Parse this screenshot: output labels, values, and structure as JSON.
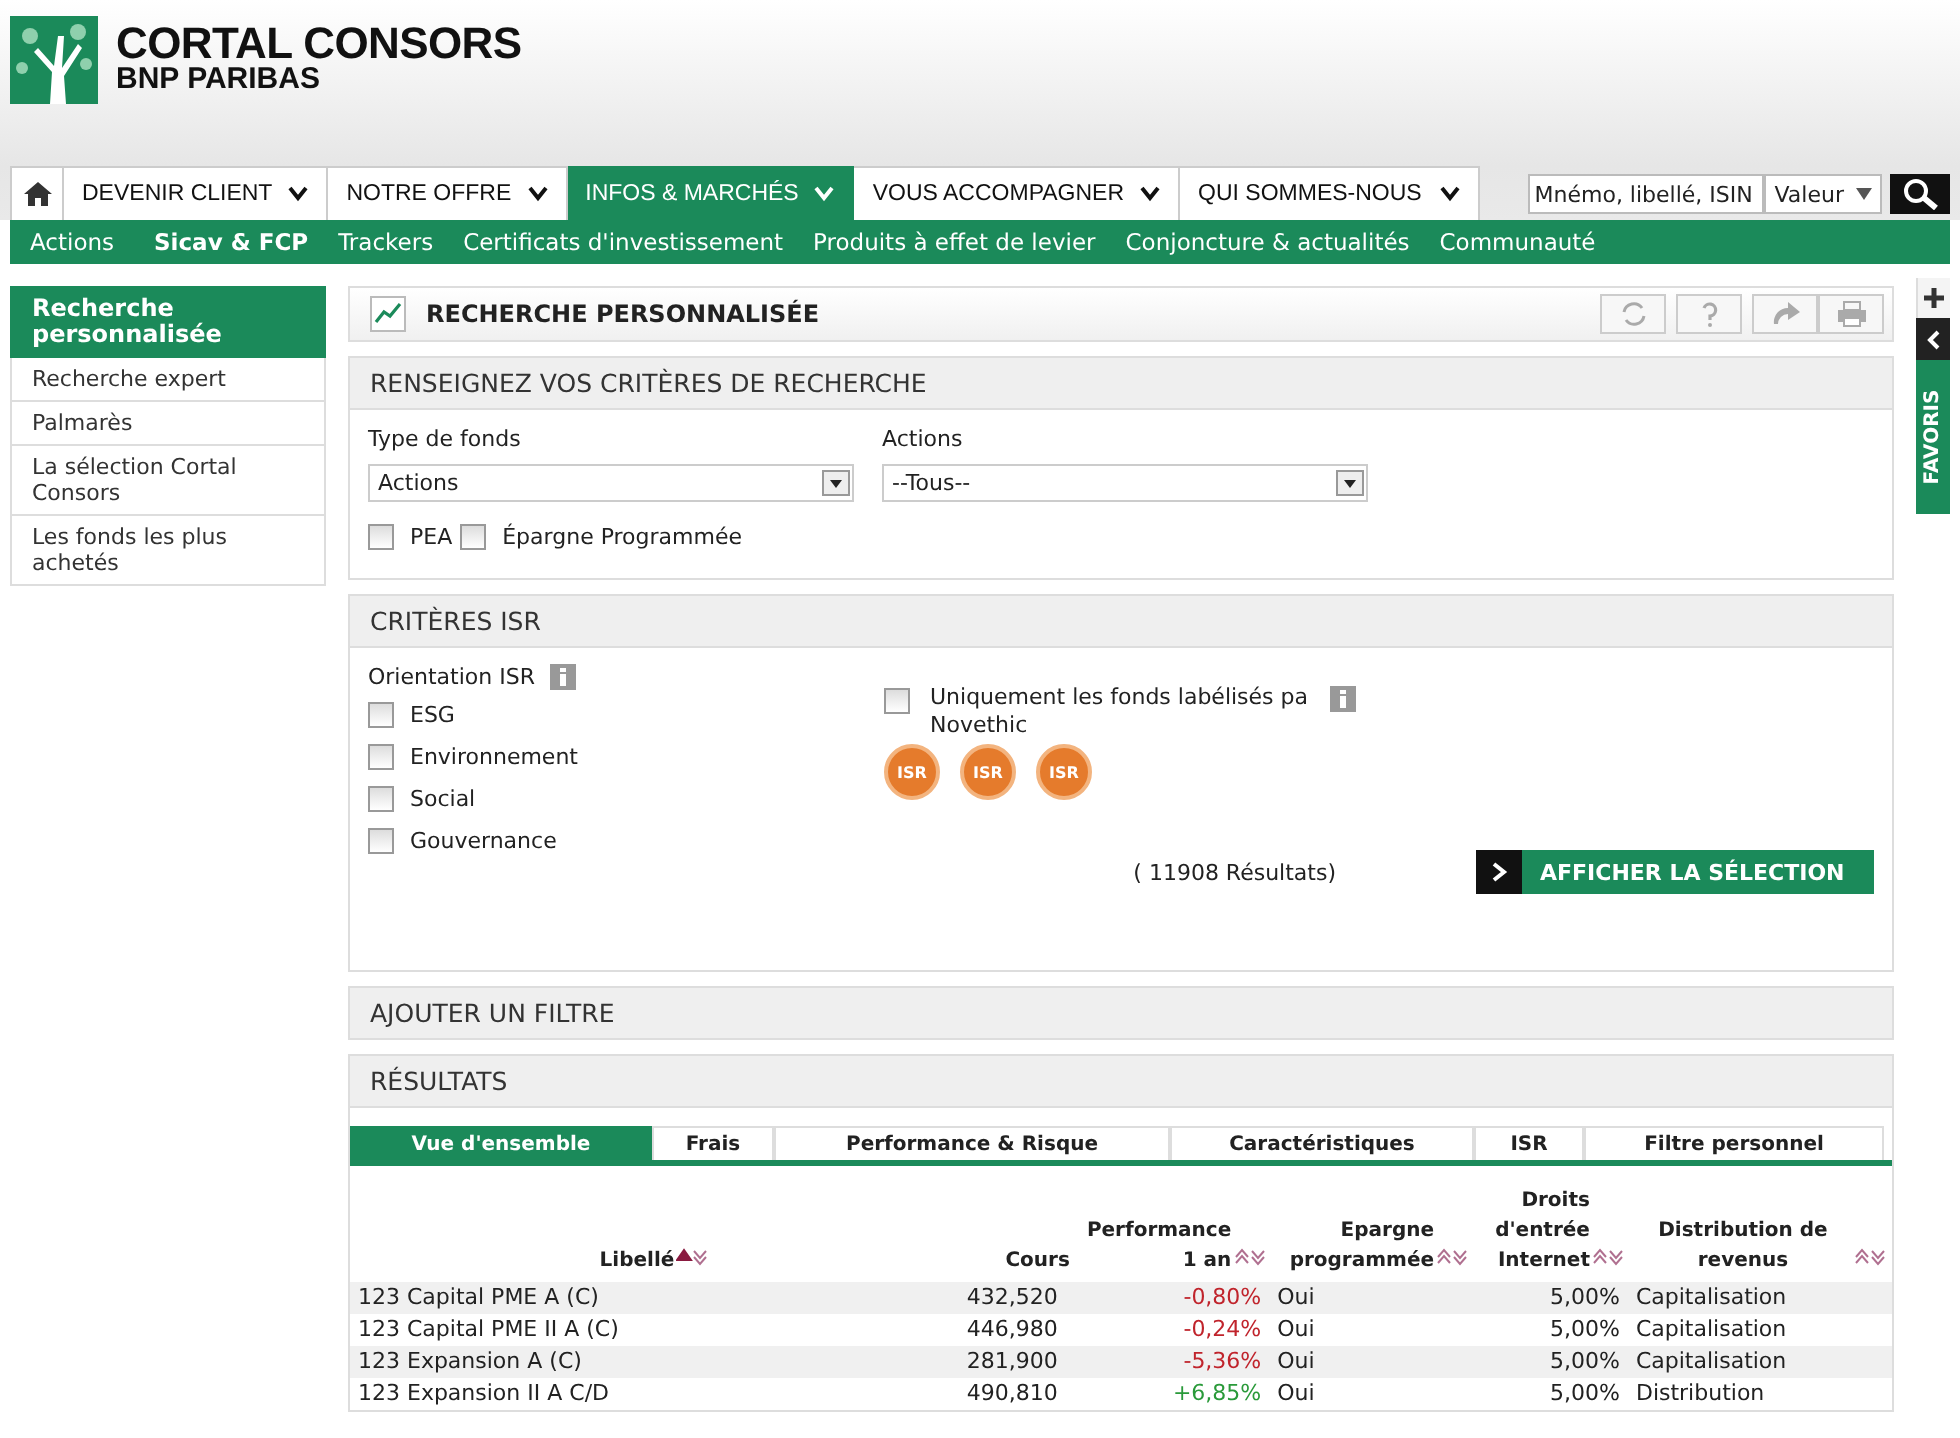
{
  "logo": {
    "name": "CORTAL CONSORS",
    "subname": "BNP PARIBAS"
  },
  "nav": {
    "items": [
      {
        "label": "DEVENIR CLIENT",
        "selected": false
      },
      {
        "label": "NOTRE OFFRE",
        "selected": false
      },
      {
        "label": "INFOS & MARCHÉS",
        "selected": true
      },
      {
        "label": "VOUS ACCOMPAGNER",
        "selected": false
      },
      {
        "label": "QUI SOMMES-NOUS",
        "selected": false
      }
    ],
    "search": {
      "value": "Mnémo, libellé, ISIN",
      "type": "Valeur"
    }
  },
  "subnav": [
    {
      "label": "Actions",
      "selected": false
    },
    {
      "label": "Sicav & FCP",
      "selected": true
    },
    {
      "label": "Trackers",
      "selected": false
    },
    {
      "label": "Certificats d'investissement",
      "selected": false
    },
    {
      "label": "Produits à effet de levier",
      "selected": false
    },
    {
      "label": "Conjoncture & actualités",
      "selected": false
    },
    {
      "label": "Communauté",
      "selected": false
    }
  ],
  "sidebar": [
    {
      "label": "Recherche personnalisée",
      "selected": true
    },
    {
      "label": "Recherche expert",
      "selected": false
    },
    {
      "label": "Palmarès",
      "selected": false
    },
    {
      "label": "La sélection Cortal Consors",
      "selected": false
    },
    {
      "label": "Les fonds les plus achetés",
      "selected": false
    }
  ],
  "page_title": "RECHERCHE PERSONNALISÉE",
  "criteria": {
    "title": "RENSEIGNEZ VOS CRITÈRES DE RECHERCHE",
    "fields": [
      {
        "label": "Type de fonds",
        "value": "Actions"
      },
      {
        "label": "Actions",
        "value": "--Tous--"
      }
    ],
    "checks": [
      {
        "label": "PEA",
        "checked": false
      },
      {
        "label": "Épargne Programmée",
        "checked": false
      }
    ]
  },
  "isr": {
    "title": "CRITÈRES ISR",
    "orientation_label": "Orientation ISR",
    "orientations": [
      {
        "label": "ESG",
        "checked": false
      },
      {
        "label": "Environnement",
        "checked": false
      },
      {
        "label": "Social",
        "checked": false
      },
      {
        "label": "Gouvernance",
        "checked": false
      }
    ],
    "label_check": {
      "label": "Uniquement les fonds labélisés pa",
      "label_2": "Novethic",
      "checked": false
    },
    "badges": [
      "ISR",
      "ISR",
      "ISR"
    ],
    "count": "( 11908 Résultats)",
    "button": "AFFICHER LA SÉLECTION"
  },
  "filter_title": "AJOUTER UN FILTRE",
  "results": {
    "title": "RÉSULTATS",
    "tabs": [
      {
        "label": "Vue d'ensemble",
        "selected": true
      },
      {
        "label": "Frais",
        "selected": false
      },
      {
        "label": "Performance & Risque",
        "selected": false
      },
      {
        "label": "Caractéristiques",
        "selected": false
      },
      {
        "label": "ISR",
        "selected": false
      },
      {
        "label": "Filtre personnel",
        "selected": false
      }
    ],
    "columns": [
      {
        "label": "Libellé",
        "sorted": true
      },
      {
        "label": "Cours"
      },
      {
        "label": "Performance 1 an",
        "sorted": false
      },
      {
        "label": "Epargne programmée",
        "sorted": false
      },
      {
        "label": "Droits d'entrée Internet",
        "sorted": false
      },
      {
        "label": "Distribution de revenus",
        "sorted": false
      }
    ],
    "rows": [
      {
        "name": "123 Capital PME A (C)",
        "cours": "432,520",
        "perf": "-0,80%",
        "color": "#c0242c",
        "epargne": "Oui",
        "droits": "5,00%",
        "distribution": "Capitalisation"
      },
      {
        "name": "123 Capital PME II A (C)",
        "cours": "446,980",
        "perf": "-0,24%",
        "color": "#c0242c",
        "epargne": "Oui",
        "droits": "5,00%",
        "distribution": "Capitalisation"
      },
      {
        "name": "123 Expansion A (C)",
        "cours": "281,900",
        "perf": "-5,36%",
        "color": "#c0242c",
        "epargne": "Oui",
        "droits": "5,00%",
        "distribution": "Capitalisation"
      },
      {
        "name": "123 Expansion II A C/D",
        "cours": "490,810",
        "perf": "+6,85%",
        "color": "#2a9a3a",
        "epargne": "Oui",
        "droits": "5,00%",
        "distribution": "Distribution"
      }
    ]
  },
  "rail": {
    "label": "FAVORIS"
  }
}
